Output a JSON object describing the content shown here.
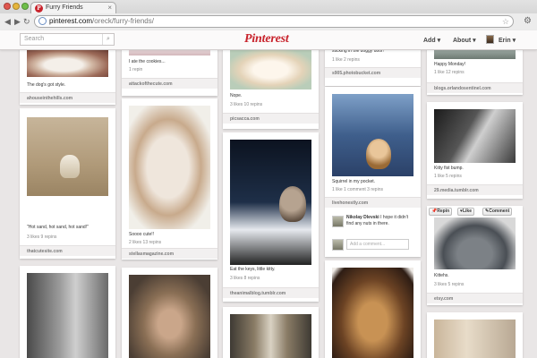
{
  "browser": {
    "tab_title": "Furry Friends",
    "url_host": "pinterest.com",
    "url_path": "/oreck/furry-friends/"
  },
  "header": {
    "search_placeholder": "Search",
    "logo": "Pinterest",
    "add_label": "Add",
    "about_label": "About",
    "user_name": "Erin"
  },
  "pins": {
    "c1p1": {
      "caption": "The dog's got style.",
      "source": "ahouseinthehills.com"
    },
    "c1p2": {
      "caption": "\"Hot sand, hot sand, hot sand!\"",
      "stats": "3 likes   9 repins",
      "source": "thatcutesite.com"
    },
    "c2p1": {
      "caption": "I ate the cookies...",
      "stats": "1 repin",
      "source": "attackofthecute.com"
    },
    "c2p2": {
      "caption": "Soooo cute!!",
      "stats": "2 likes   13 repins",
      "source": "stellasmagazine.com"
    },
    "c3p1": {
      "caption": "Nope.",
      "stats": "3 likes   10 repins",
      "source": "picsacca.com"
    },
    "c3p2": {
      "caption": "Eat the keys, little kitty.",
      "stats": "3 likes   8 repins",
      "source": "theanimalblog.tumblr.com"
    },
    "c4p1": {
      "caption": "sticking in the doggy door!",
      "stats": "1 like   2 repins",
      "source": "s905.photobucket.com"
    },
    "c4p2": {
      "caption": "Squirrel in my pocket.",
      "stats": "1 like   1 comment   3 repins",
      "source": "livehonestly.com",
      "commenter": "Nikolay Dlevski",
      "comment": "I hope it didn't find any nuts in there.",
      "add_comment_placeholder": "Add a comment..."
    },
    "c5p1": {
      "caption": "Happy Monday!",
      "stats": "1 like   12 repins",
      "source": "blogs.orlandosentinel.com"
    },
    "c5p2": {
      "caption": "Kitty fist bump.",
      "stats": "1 like   5 repins",
      "source": "29.media.tumblr.com"
    },
    "c5p3": {
      "caption": "Kittehs.",
      "stats": "3 likes   5 repins",
      "source": "etsy.com",
      "repin_label": "Repin",
      "like_label": "Like",
      "comment_label": "Comment"
    }
  }
}
